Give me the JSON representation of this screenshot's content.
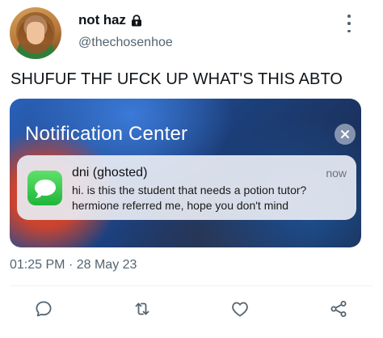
{
  "tweet": {
    "author": {
      "display_name": "not haz",
      "handle": "@thechosenhoe",
      "protected": true
    },
    "text": "SHUFUF THF UFCK UP WHAT'S THIS ABTO",
    "timestamp": "01:25 PM",
    "date": "28 May 23",
    "meta_separator": "·"
  },
  "media": {
    "panel_title": "Notification Center",
    "notification": {
      "sender": "dni (ghosted)",
      "time": "now",
      "line1": "hi. is this the student that needs a potion tutor?",
      "line2": "hermione referred me, hope you don't mind",
      "app_icon": "messages-icon"
    }
  },
  "actions": {
    "icons": [
      "reply-icon",
      "retweet-icon",
      "like-icon",
      "share-icon"
    ]
  },
  "colors": {
    "text_primary": "#0f1419",
    "text_secondary": "#536471",
    "messages_green": "#1fb63a"
  }
}
